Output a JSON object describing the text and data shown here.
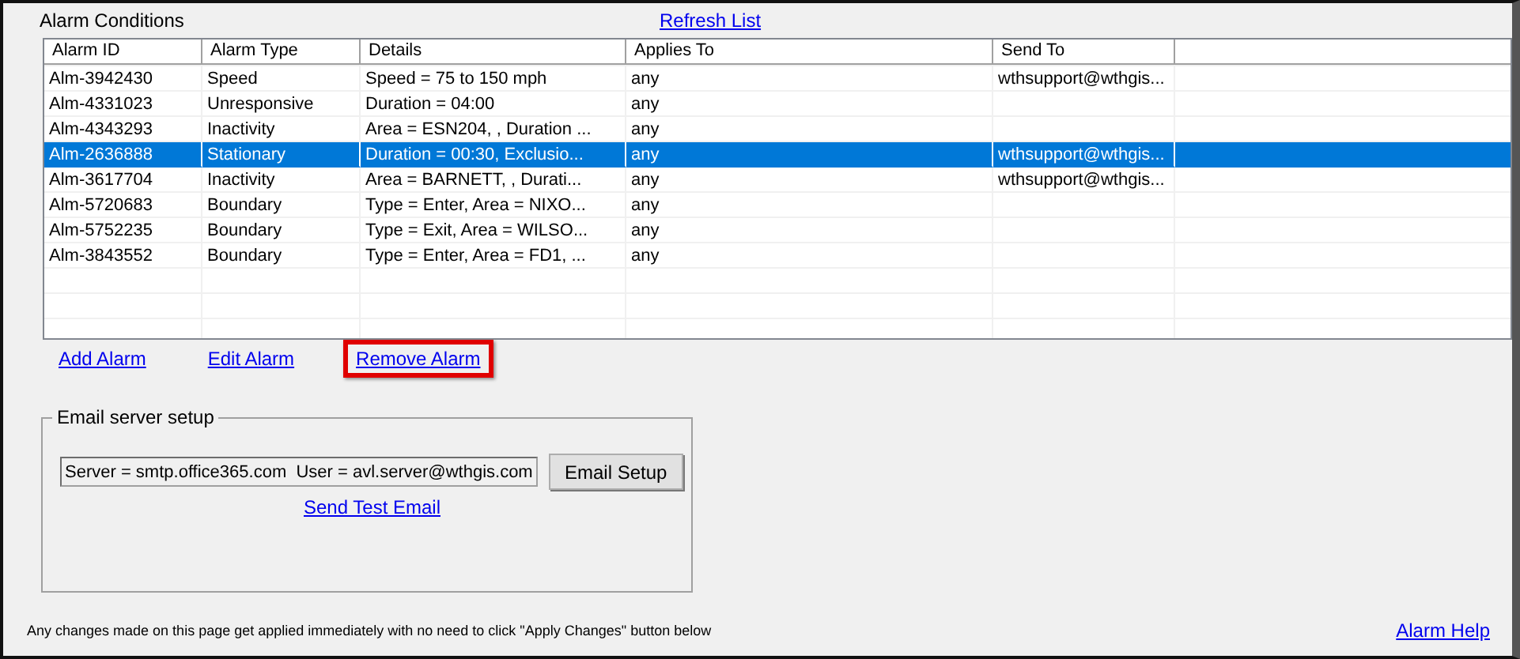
{
  "section_title": "Alarm Conditions",
  "refresh_link": "Refresh List",
  "table": {
    "columns": [
      "Alarm ID",
      "Alarm Type",
      "Details",
      "Applies To",
      "Send To"
    ],
    "rows": [
      {
        "cells": [
          "Alm-3942430",
          "Speed",
          "Speed = 75 to 150 mph",
          "any",
          "wthsupport@wthgis..."
        ],
        "selected": false
      },
      {
        "cells": [
          "Alm-4331023",
          "Unresponsive",
          "Duration = 04:00",
          "any",
          ""
        ],
        "selected": false
      },
      {
        "cells": [
          "Alm-4343293",
          "Inactivity",
          "Area = ESN204, , Duration ...",
          "any",
          ""
        ],
        "selected": false
      },
      {
        "cells": [
          "Alm-2636888",
          "Stationary",
          "Duration = 00:30, Exclusio...",
          "any",
          "wthsupport@wthgis..."
        ],
        "selected": true
      },
      {
        "cells": [
          "Alm-3617704",
          "Inactivity",
          "Area = BARNETT, , Durati...",
          "any",
          "wthsupport@wthgis..."
        ],
        "selected": false
      },
      {
        "cells": [
          "Alm-5720683",
          "Boundary",
          "Type = Enter, Area = NIXO...",
          "any",
          ""
        ],
        "selected": false
      },
      {
        "cells": [
          "Alm-5752235",
          "Boundary",
          "Type = Exit, Area = WILSO...",
          "any",
          ""
        ],
        "selected": false
      },
      {
        "cells": [
          "Alm-3843552",
          "Boundary",
          "Type = Enter, Area = FD1, ...",
          "any",
          ""
        ],
        "selected": false
      }
    ]
  },
  "actions": [
    {
      "label": "Add Alarm",
      "highlighted": false
    },
    {
      "label": "Edit Alarm",
      "highlighted": false
    },
    {
      "label": "Remove Alarm",
      "highlighted": true
    }
  ],
  "email_group": {
    "title": "Email server setup",
    "server_info": "Server = smtp.office365.com  User = avl.server@wthgis.com",
    "setup_button": "Email Setup",
    "test_link": "Send Test Email"
  },
  "footer_note": "Any changes made on this page get applied immediately with no need to click \"Apply Changes\" button below",
  "help_link": "Alarm Help"
}
